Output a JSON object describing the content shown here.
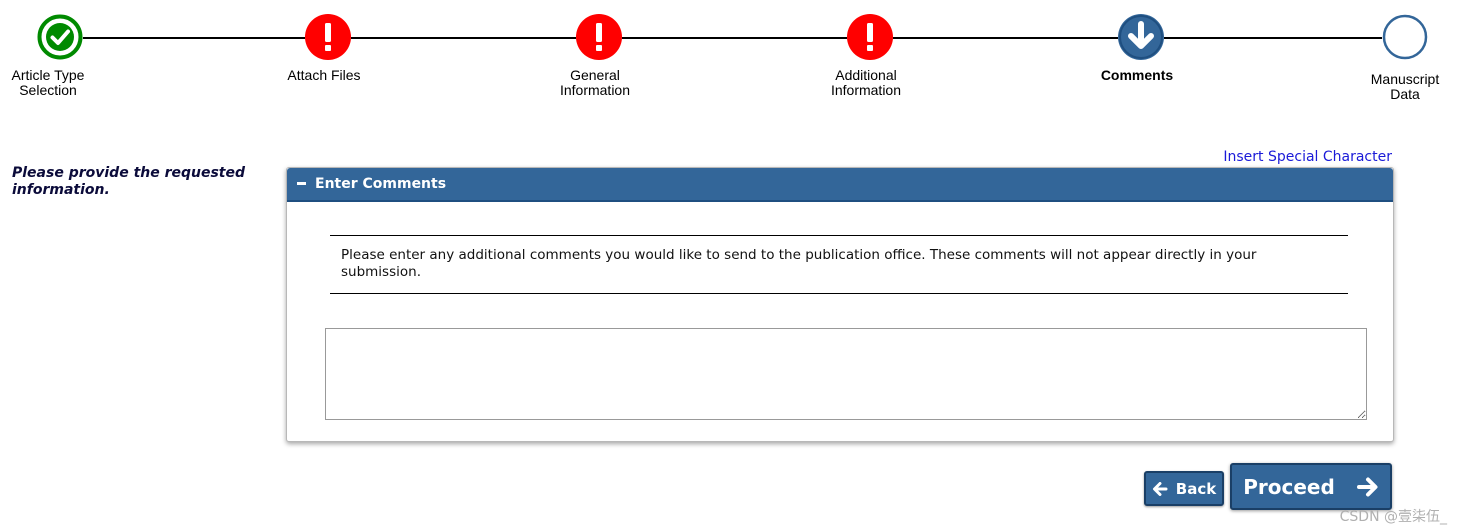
{
  "stepper": {
    "steps": [
      {
        "label": "Article Type Selection",
        "status": "complete",
        "icon": "checkmark-icon",
        "color": "#008a00"
      },
      {
        "label": "Attach Files",
        "status": "error",
        "icon": "exclamation-icon",
        "color": "#ff0000"
      },
      {
        "label": "General Information",
        "status": "error",
        "icon": "exclamation-icon",
        "color": "#ff0000"
      },
      {
        "label": "Additional Information",
        "status": "error",
        "icon": "exclamation-icon",
        "color": "#ff0000"
      },
      {
        "label": "Comments",
        "status": "current",
        "icon": "arrow-down-icon",
        "color": "#336699"
      },
      {
        "label": "Manuscript Data",
        "status": "pending",
        "icon": "empty-circle-icon",
        "color": "#336699"
      }
    ]
  },
  "instruction": "Please provide the requested information.",
  "insert_special_character": "Insert Special Character",
  "panel": {
    "title": "Enter Comments",
    "note": "Please enter any additional comments you would like to send to the publication office. These comments will not appear directly in your submission.",
    "comments_value": ""
  },
  "buttons": {
    "back": "Back",
    "proceed": "Proceed"
  },
  "watermark": "CSDN @壹柒伍_",
  "colors": {
    "accent": "#336699",
    "error": "#ff0000",
    "complete": "#008a00",
    "link": "#1a1ad8"
  }
}
